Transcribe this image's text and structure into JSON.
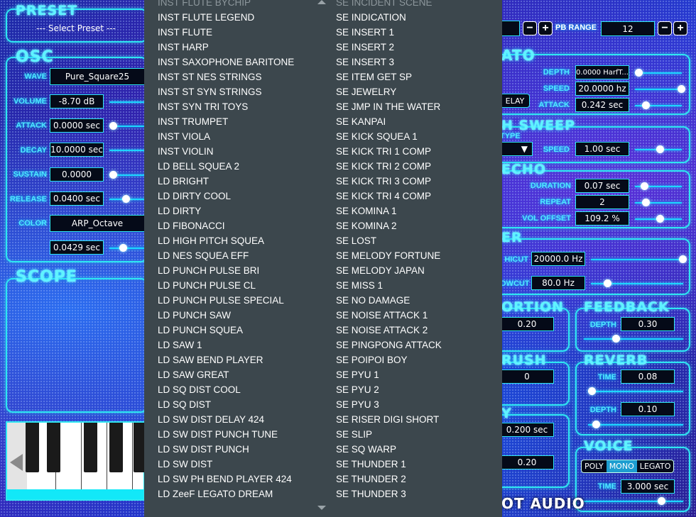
{
  "preset": {
    "title": "PRESET",
    "selected": "--- Select Preset ---"
  },
  "osc": {
    "title": "OSC",
    "wave_label": "WAVE",
    "wave_value": "Pure_Square25",
    "volume_label": "VOLUME",
    "volume_value": "-8.70 dB",
    "attack_label": "ATTACK",
    "attack_value": "0.0000 sec",
    "decay_label": "DECAY",
    "decay_value": "10.0000 sec",
    "sustain_label": "SUSTAIN",
    "sustain_value": "0.0000",
    "release_label": "RELEASE",
    "release_value": "0.0400 sec",
    "color_label": "COLOR",
    "color_value": "ARP_Octave",
    "extra_value": "0.0429 sec"
  },
  "scope": {
    "title": "SCOPE"
  },
  "pb_range": {
    "label": "PB RANGE",
    "value": "12",
    "minus": "−",
    "plus": "+"
  },
  "legato": {
    "title_fragment": "ATO",
    "depth_label": "DEPTH",
    "depth_value": "0.0000 HarfT...",
    "speed_label": "SPEED",
    "speed_value": "20.0000 hz",
    "attack_label": "ATTACK",
    "attack_value": "0.242 sec",
    "delay_button": "ELAY"
  },
  "pitch_sweep": {
    "title_fragment": "H SWEEP",
    "type_label": "TYPE",
    "speed_label": "SPEED",
    "speed_value": "1.00 sec"
  },
  "echo": {
    "title_fragment": "ECHO",
    "duration_label": "DURATION",
    "duration_value": "0.07 sec",
    "repeat_label": "REPEAT",
    "repeat_value": "2",
    "vol_offset_label": "VOL OFFSET",
    "vol_offset_value": "109.2 %"
  },
  "filter": {
    "title_fragment": "ER",
    "hicut_label": "HICUT",
    "hicut_value": "20000.0 Hz",
    "lowcut_label": "OWCUT",
    "lowcut_value": "80.0 Hz"
  },
  "distortion": {
    "title_fragment": "ORTION",
    "value": "0.20"
  },
  "feedback": {
    "title": "FEEDBACK",
    "depth_label": "DEPTH",
    "depth_value": "0.30"
  },
  "bitcrush": {
    "title_fragment": "RUSH",
    "value": "0"
  },
  "reverb": {
    "title": "REVERB",
    "time_label": "TIME",
    "time_value": "0.08",
    "depth_label": "DEPTH",
    "depth_value": "0.10"
  },
  "delay_fx": {
    "title_fragment": "Y",
    "time_value": "0.200 sec",
    "amount_value": "0.20"
  },
  "voice": {
    "title": "VOICE",
    "modes": [
      "POLY",
      "MONO",
      "LEGATO"
    ],
    "selected": "MONO",
    "time_label": "TIME",
    "time_value": "3.000 sec"
  },
  "brand": {
    "fragment": "OT AUDIO"
  },
  "dropdown": {
    "left_column": [
      "INST FLUTE BYCHIP",
      "INST FLUTE LEGEND",
      "INST FLUTE",
      "INST HARP",
      "INST SAXOPHONE BARITONE",
      "INST ST NES STRINGS",
      "INST ST SYN STRINGS",
      "INST SYN TRI TOYS",
      "INST TRUMPET",
      "INST VIOLA",
      "INST VIOLIN",
      "LD BELL SQUEA 2",
      "LD BRIGHT",
      "LD DIRTY COOL",
      "LD DIRTY",
      "LD FIBONACCI",
      "LD HIGH PITCH SQUEA",
      "LD NES SQUEA EFF",
      "LD PUNCH PULSE BRI",
      "LD PUNCH PULSE CL",
      "LD PUNCH PULSE SPECIAL",
      "LD PUNCH SAW",
      "LD PUNCH SQUEA",
      "LD SAW 1",
      "LD SAW BEND PLAYER",
      "LD SAW GREAT",
      "LD SQ DIST COOL",
      "LD SQ DIST",
      "LD SW DIST DELAY 424",
      "LD SW DIST PUNCH TUNE",
      "LD SW DIST PUNCH",
      "LD SW DIST",
      "LD SW PH BEND PLAYER 424",
      "LD ZeeF LEGATO DREAM"
    ],
    "right_column": [
      "SE INCIDENT SCENE",
      "SE INDICATION",
      "SE INSERT 1",
      "SE INSERT 2",
      "SE INSERT 3",
      "SE ITEM GET SP",
      "SE JEWELRY",
      "SE JMP IN THE WATER",
      "SE KANPAI",
      "SE KICK SQUEA 1",
      "SE KICK TRI 1 COMP",
      "SE KICK TRI 2 COMP",
      "SE KICK TRI 3 COMP",
      "SE KICK TRI 4 COMP",
      "SE KOMINA 1",
      "SE KOMINA 2",
      "SE LOST",
      "SE MELODY FORTUNE",
      "SE MELODY JAPAN",
      "SE MISS 1",
      "SE NO DAMAGE",
      "SE NOISE ATTACK 1",
      "SE NOISE ATTACK 2",
      "SE PINGPONG ATTACK",
      "SE POIPOI BOY",
      "SE PYU 1",
      "SE PYU 2",
      "SE PYU 3",
      "SE RISER DIGI SHORT",
      "SE SLIP",
      "SE SQ WARP",
      "SE THUNDER 1",
      "SE THUNDER 2",
      "SE THUNDER 3"
    ]
  }
}
